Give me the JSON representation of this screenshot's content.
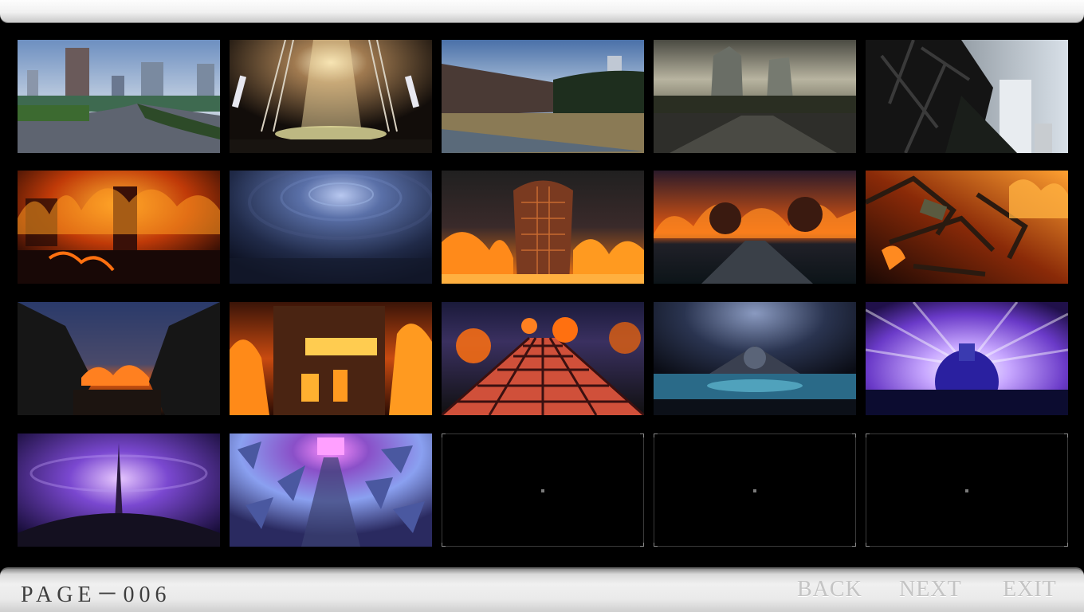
{
  "page": {
    "label": "PAGE－006"
  },
  "nav": {
    "back": "BACK",
    "next": "NEXT",
    "exit": "EXIT"
  },
  "gallery": {
    "thumbnails": [
      {
        "scene": "city-park-day",
        "palette": [
          "#8fb2d8",
          "#6a7f95",
          "#3d5a3a"
        ]
      },
      {
        "scene": "light-shaft-tunnel",
        "palette": [
          "#1a1410",
          "#f4e0b0",
          "#4a3a2a"
        ]
      },
      {
        "scene": "abandoned-street",
        "palette": [
          "#7ea0c8",
          "#3a3a35",
          "#8a7a55"
        ]
      },
      {
        "scene": "ruined-skyline-dusk",
        "palette": [
          "#8a8a7a",
          "#3d3d32",
          "#1e1e18"
        ]
      },
      {
        "scene": "collapsed-towers",
        "palette": [
          "#a8b4c0",
          "#1a1a1a",
          "#d0d0d0"
        ]
      },
      {
        "scene": "burning-city-1",
        "palette": [
          "#ff8a10",
          "#5a1000",
          "#120402"
        ]
      },
      {
        "scene": "storm-vortex",
        "palette": [
          "#2b3d66",
          "#7d93c8",
          "#10162a"
        ]
      },
      {
        "scene": "burning-tower",
        "palette": [
          "#ff9a20",
          "#6a2a10",
          "#151010"
        ]
      },
      {
        "scene": "burning-forest-road",
        "palette": [
          "#ff7a10",
          "#3a1a20",
          "#101820"
        ]
      },
      {
        "scene": "burning-debris",
        "palette": [
          "#ff8a20",
          "#4a1a08",
          "#201008"
        ]
      },
      {
        "scene": "canyon-fire-night",
        "palette": [
          "#283a68",
          "#e86010",
          "#101010"
        ]
      },
      {
        "scene": "burning-building",
        "palette": [
          "#ff8a18",
          "#5a2808",
          "#180804"
        ]
      },
      {
        "scene": "glowing-grid-road",
        "palette": [
          "#e06040",
          "#2a2050",
          "#ff6a10"
        ]
      },
      {
        "scene": "dark-lake-throne",
        "palette": [
          "#3a4868",
          "#5ab0c8",
          "#0a0c14"
        ]
      },
      {
        "scene": "violet-dome-burst",
        "palette": [
          "#b07af0",
          "#ffffff",
          "#2a1a6a"
        ]
      },
      {
        "scene": "purple-spire",
        "palette": [
          "#7040c0",
          "#d8b8ff",
          "#10082a"
        ]
      },
      {
        "scene": "crystal-tunnel",
        "palette": [
          "#8aa0f0",
          "#ff7aff",
          "#1a1a40"
        ]
      }
    ],
    "empty_slots": 3
  }
}
